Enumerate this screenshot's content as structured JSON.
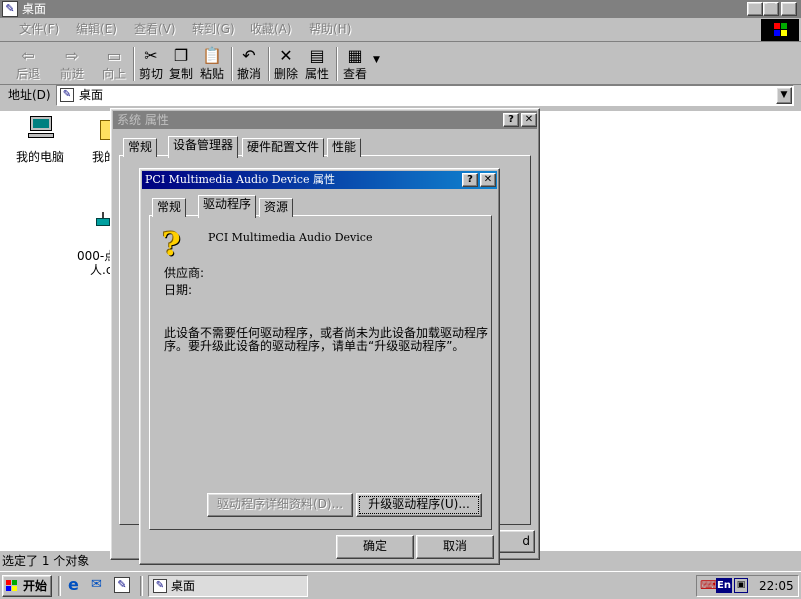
{
  "explorer": {
    "title": "桌面",
    "menu": [
      "文件(F)",
      "编辑(E)",
      "查看(V)",
      "转到(G)",
      "收藏(A)",
      "帮助(H)"
    ],
    "toolbar": {
      "back": "后退",
      "forward": "前进",
      "up": "向上",
      "cut": "剪切",
      "copy": "复制",
      "paste": "粘贴",
      "undo": "撤消",
      "delete": "删除",
      "properties": "属性",
      "views": "查看"
    },
    "address_label": "地址(D)",
    "address_value": "桌面",
    "desktop_icons": [
      "我的电脑",
      "我的",
      "000-点",
      "人.c"
    ],
    "status_text": "选定了 1 个对象"
  },
  "sysprops": {
    "title": "系统 属性",
    "tabs": [
      "常规",
      "设备管理器",
      "硬件配置文件",
      "性能"
    ],
    "partial_button": "d"
  },
  "device": {
    "title": "PCI Multimedia Audio Device 属性",
    "tabs": [
      "常规",
      "驱动程序",
      "资源"
    ],
    "device_name": "PCI Multimedia Audio Device",
    "provider_label": "供应商:",
    "date_label": "日期:",
    "description_line1": "此设备不需要任何驱动程序，或者尚未为此设备加载驱动程序",
    "description_line2": "序。要升级此设备的驱动程序，请单击“升级驱动程序”。",
    "details_button": "驱动程序详细资料(D)...",
    "upgrade_button": "升级驱动程序(U)...",
    "ok_button": "确定",
    "cancel_button": "取消"
  },
  "taskbar": {
    "start_label": "开始",
    "task_label": "桌面",
    "tray_lang": "En",
    "clock": "22:05"
  }
}
